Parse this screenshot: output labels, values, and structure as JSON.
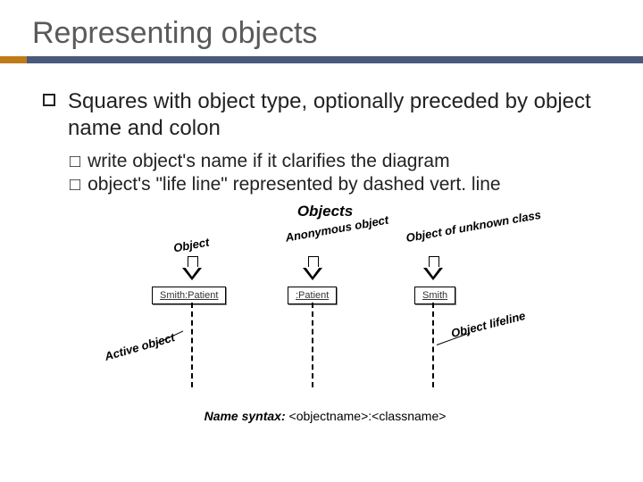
{
  "title": "Representing objects",
  "bullet": "Squares with object type, optionally preceded by object name and colon",
  "sub": [
    "write object's name if it clarifies the diagram",
    "object's \"life line\" represented by dashed vert. line"
  ],
  "diagram": {
    "heading": "Objects",
    "topLabels": [
      "Object",
      "Anonymous object",
      "Object of unknown class"
    ],
    "boxes": [
      "Smith:Patient",
      ":Patient",
      "Smith"
    ],
    "leftAnnot": "Active object",
    "rightAnnot": "Object lifeline",
    "syntaxLabel": "Name syntax:",
    "syntaxValue": "<objectname>:<classname>"
  }
}
